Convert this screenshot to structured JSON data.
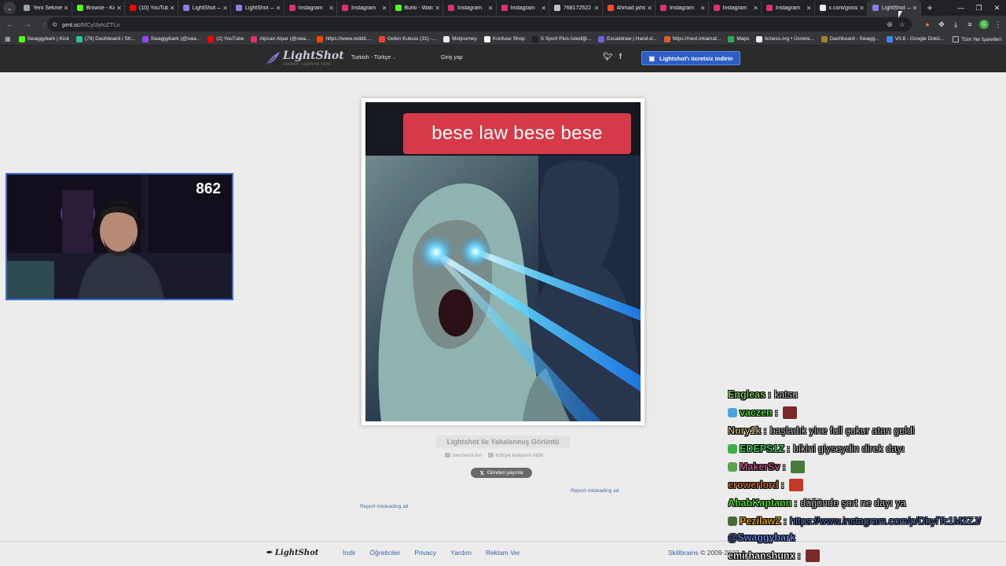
{
  "browser": {
    "tabs": [
      {
        "title": "Yeni Sekme",
        "color": "#9aa0a6"
      },
      {
        "title": "Browse - Kick",
        "color": "#53fc18"
      },
      {
        "title": "(10) YouTube",
        "color": "#ff0000"
      },
      {
        "title": "LightShot —",
        "color": "#8a7fe8"
      },
      {
        "title": "LightShot —",
        "color": "#8a7fe8"
      },
      {
        "title": "Instagram",
        "color": "#e1306c"
      },
      {
        "title": "Instagram",
        "color": "#e1306c"
      },
      {
        "title": "Burki - Watc",
        "color": "#53fc18"
      },
      {
        "title": "Instagram",
        "color": "#e1306c"
      },
      {
        "title": "Instagram",
        "color": "#e1306c"
      },
      {
        "title": "768172522",
        "color": "#bdc1c6"
      },
      {
        "title": "Ahmad jahs",
        "color": "#ff4a2a"
      },
      {
        "title": "Instagram",
        "color": "#e1306c"
      },
      {
        "title": "Instagram",
        "color": "#e1306c"
      },
      {
        "title": "Instagram",
        "color": "#e1306c"
      },
      {
        "title": "x.com/gossi",
        "color": "#e8eaed"
      },
      {
        "title": "LightShot —",
        "color": "#8a7fe8",
        "active": true
      }
    ],
    "url_host": "prnt.sc",
    "url_path": "/MCyl3ytoZTLn",
    "bookmarks": [
      {
        "label": "Swaggybark | Kick",
        "color": "#53fc18"
      },
      {
        "label": "(79) Dashboard / Str...",
        "color": "#21c5a0"
      },
      {
        "label": "Swaggybark (@swa...",
        "color": "#9146ff"
      },
      {
        "label": "(2) YouTube",
        "color": "#ff0000"
      },
      {
        "label": "Alpcan Alpar (@swa...",
        "color": "#e1306c"
      },
      {
        "label": "https://www.reddit....",
        "color": "#ff4500"
      },
      {
        "label": "Gelen Kutusu (31) -...",
        "color": "#ea4335"
      },
      {
        "label": "Midjourney",
        "color": "#e8eaed"
      },
      {
        "label": "Konfuse Shop",
        "color": "#ffffff"
      },
      {
        "label": "S Sport Plus-İstediği...",
        "color": "#202124"
      },
      {
        "label": "Excalidraw | Hand-d...",
        "color": "#6965db"
      },
      {
        "label": "https://next.inkamat...",
        "color": "#e05a2a"
      },
      {
        "label": "Maps",
        "color": "#34a853"
      },
      {
        "label": "lichess.org • Ücretsi...",
        "color": "#e8eaed"
      },
      {
        "label": "Dashboard - Swagg...",
        "color": "#a0822a"
      },
      {
        "label": "V0.8 - Google Dokü...",
        "color": "#4285f4"
      }
    ],
    "all_bookmarks": "Tüm Yer İşaretleri"
  },
  "header": {
    "logo_name": "LightShot",
    "logo_tagline": "screen capture tool",
    "language": "Turkish - Türkçe",
    "login": "Giriş yap",
    "download_button": "Lightshot'ı ücretsiz indirin"
  },
  "screenshot": {
    "caption": "bese law bese bese",
    "title": "Lightshot ile Yakalanmış Görüntü",
    "similar_link": "benzerini bul",
    "abuse_link": "kötüye kullanım bildir",
    "tweet_button": "Gönderi yayınla",
    "report_ad_right": "Report misleading ad",
    "report_ad_left": "Report misleading ad"
  },
  "footer": {
    "logo": "LightShot",
    "links": [
      "İndir",
      "Öğreticiler",
      "Privacy",
      "Yardım",
      "Reklam Ver"
    ],
    "copyright_brand": "Skillbrains",
    "copyright_years": "© 2009-2022"
  },
  "stream": {
    "viewer_count": "862",
    "chat": [
      {
        "user": "Engleas",
        "color": "#8de65a",
        "message": "katsu"
      },
      {
        "user": "vaczen",
        "color": "#53fc18",
        "message": "",
        "badge": "#4aa3df",
        "emote": "#7a2a2a"
      },
      {
        "user": "Nury1k",
        "color": "#d9c07a",
        "message": "başladık yine full çukur atan geldi"
      },
      {
        "user": "EDEPS1Z",
        "color": "#3cf05a",
        "message": "bikini giyseydin direk dayı",
        "badge": "#3cb043"
      },
      {
        "user": "MakerSv",
        "color": "#e05aa0",
        "message": "",
        "badge": "#5aa34a",
        "emote": "#4a7a3a"
      },
      {
        "user": "erowerlord",
        "color": "#e07a2a",
        "message": "",
        "emote": "#c0392b"
      },
      {
        "user": "AhabKaptann",
        "color": "#53fc18",
        "message": "düğünde şort ne dayı ya"
      },
      {
        "user": "PezilawZ",
        "color": "#ffb400",
        "message": "https://www.instagram.com/p/DbyfTc1M2ZJ/",
        "badge": "#4a6a3a",
        "link": true
      },
      {
        "user": "",
        "color": "#6e97ff",
        "message": "@Swaggybark",
        "continuation": true
      },
      {
        "user": "emirhanshunx",
        "color": "#ffffff",
        "message": "",
        "emote": "#7a2a2a"
      }
    ]
  },
  "colors": {
    "page_bg": "#ececec",
    "header_bg": "#2b2b2b",
    "download_btn": "#2c5cc5",
    "link": "#3a63a8",
    "chrome_dark": "#202124",
    "chrome_toolbar": "#35363a"
  }
}
